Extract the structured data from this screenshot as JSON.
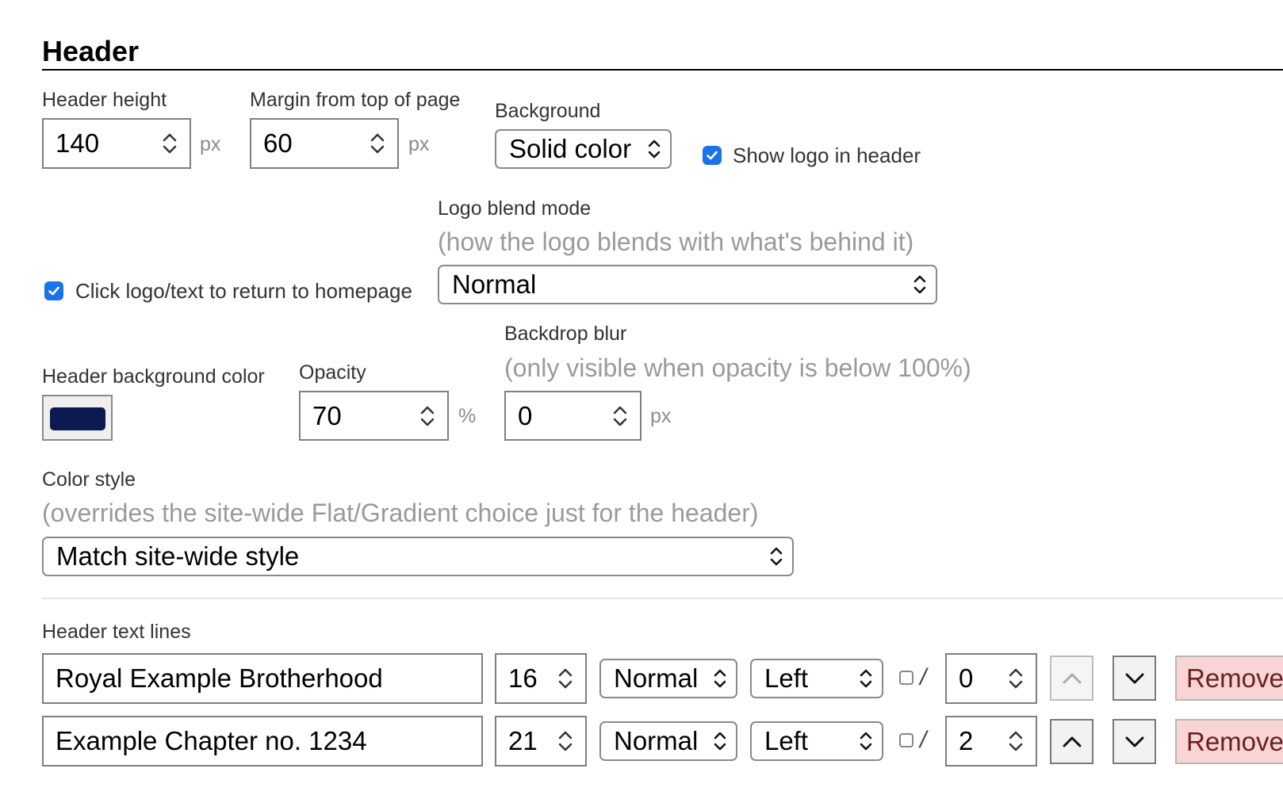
{
  "section": {
    "title": "Header"
  },
  "header_height": {
    "label": "Header height",
    "value": "140",
    "unit": "px"
  },
  "margin_top": {
    "label": "Margin from top of page",
    "value": "60",
    "unit": "px"
  },
  "background": {
    "label": "Background",
    "selected": "Solid color"
  },
  "show_logo": {
    "label": "Show logo in header",
    "checked": true
  },
  "click_logo": {
    "label": "Click logo/text to return to homepage",
    "checked": true
  },
  "logo_blend": {
    "label": "Logo blend mode",
    "hint": "(how the logo blends with what's behind it)",
    "selected": "Normal"
  },
  "header_bg_color": {
    "label": "Header background color",
    "color": "#0c1a50"
  },
  "opacity": {
    "label": "Opacity",
    "value": "70",
    "unit": "%"
  },
  "backdrop_blur": {
    "label": "Backdrop blur",
    "hint": "(only visible when opacity is below 100%)",
    "value": "0",
    "unit": "px"
  },
  "color_style": {
    "label": "Color style",
    "hint": "(overrides the site-wide Flat/Gradient choice just for the header)",
    "selected": "Match site-wide style"
  },
  "text_lines": {
    "label": "Header text lines",
    "rows": [
      {
        "text": "Royal Example Brotherhood",
        "size": "16",
        "weight": "Normal",
        "align": "Left",
        "slash": "/",
        "spacing": "0",
        "remove_label": "Remove",
        "up_enabled": false
      },
      {
        "text": "Example Chapter no. 1234",
        "size": "21",
        "weight": "Normal",
        "align": "Left",
        "slash": "/",
        "spacing": "2",
        "remove_label": "Remove",
        "up_enabled": true
      }
    ]
  },
  "colors": {
    "accent": "#1a73e8",
    "remove_bg": "#f8d4d4"
  }
}
